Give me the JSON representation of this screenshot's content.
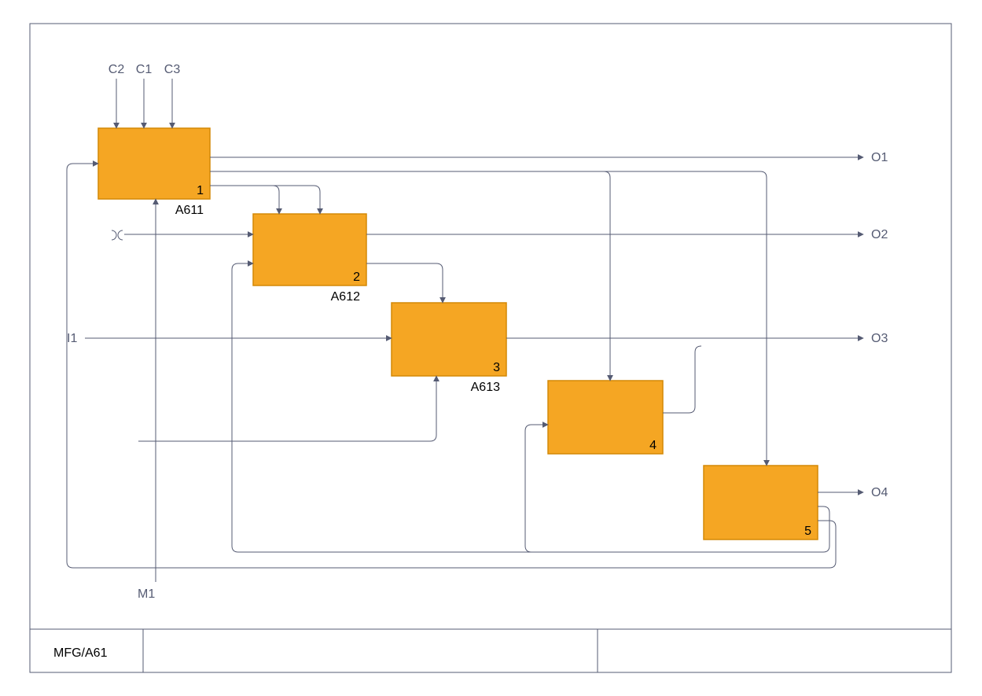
{
  "diagram": {
    "title": "MFG/A61",
    "controls": [
      "C2",
      "C1",
      "C3"
    ],
    "inputs": [
      "I1"
    ],
    "mechanisms": [
      "M1"
    ],
    "outputs": [
      "O1",
      "O2",
      "O3",
      "O4"
    ],
    "boxes": [
      {
        "num": "1",
        "code": "A611"
      },
      {
        "num": "2",
        "code": "A612"
      },
      {
        "num": "3",
        "code": "A613"
      },
      {
        "num": "4",
        "code": ""
      },
      {
        "num": "5",
        "code": ""
      }
    ]
  }
}
